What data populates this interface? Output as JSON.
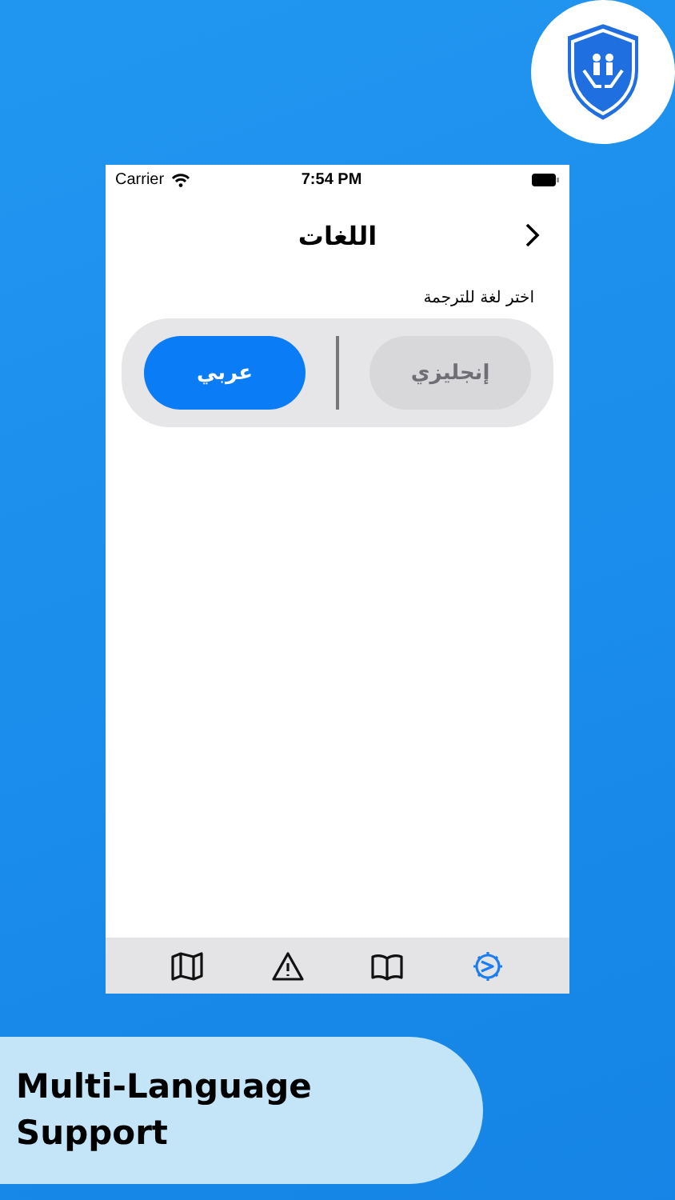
{
  "status_bar": {
    "carrier": "Carrier",
    "time": "7:54 PM"
  },
  "nav": {
    "title": "اللغات"
  },
  "prompt": "اختر لغة للترجمة",
  "language_options": [
    {
      "label": "إنجليزي",
      "selected": false
    },
    {
      "label": "عربي",
      "selected": true
    }
  ],
  "tab_bar": [
    {
      "kind": "map",
      "selected": false
    },
    {
      "kind": "warning",
      "selected": false
    },
    {
      "kind": "book",
      "selected": false
    },
    {
      "kind": "settings",
      "selected": true
    }
  ],
  "caption": "Multi-Language Support"
}
